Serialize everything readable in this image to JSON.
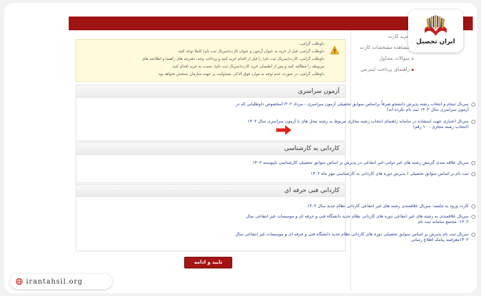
{
  "logo": {
    "text": "ایران تحصیل"
  },
  "sidebar": {
    "items": [
      {
        "label": "خرید کارت",
        "active": false
      },
      {
        "label": "مشاهده مشخصات کارت",
        "active": false
      },
      {
        "label": "سوالات متداول",
        "active": false
      },
      {
        "label": "راهنمای پرداخت اینترنتی",
        "active": true
      }
    ]
  },
  "notice": {
    "lines": [
      "داوطلب گرامی،",
      "داوطلب گرامی، قبل از خرید به عنوان آزمون و عنوان کارت(سریال ثبت نام) کاملا توجه کنید.",
      "داوطلب گرامی، کارت(سریال ثبت نام) را قبل از اقدام خرید کنید و پرداخت وجه، دفترچه های راهنما و اطلاعیه های",
      "مربوطه را مطالعه کنید و پس از اطمینان خرید کارت(سریال ثبت نام)، نسبت به خرید اقدام کنید.",
      "داوطلب گرامی، در صورت عدم توجه به موارد فوق الذکر، مسئولیت بر عهده سازمان سنجش نخواهد بود."
    ]
  },
  "sections": [
    {
      "title": "آزمون سراسری",
      "options": [
        "سریال ثبتنام و انتخاب رشته پذیرش دانشجو صرفاً براساس سوابق تحصیلی آزمون سراسری - مرداد ۱۴۰۲(مخصوص داوطلبانی که در آزمون سراسری سال ۱۴۰۲ ثبت نام نکرده اند)",
        "سریال اعتباری جهت استفاده در سامانه راهنمای انتخاب رشته مجازی مربوط به رشته محل های با آزمون سراسری سال ۱۴۰۲ (انتخاب رشته مجازی - ۱۰ رقم)"
      ]
    },
    {
      "title": "کاردانی به کارشناسی",
      "options": [
        "سریال علاقه مندی گزینش رشته های غیر دولتی-غیر انتفاعی در پذیرش بر اساس سوابق تحصیلی کارشناسی ناپیوسته ۱۴۰۲",
        "ثبت نام بر اساس سوابق تحصیلی ( پذیرش دوره های کاردانی به کارشناسی مهر ماه ۱۴۰۲"
      ]
    },
    {
      "title": "کاردانی فنی حرفه ای",
      "options": [
        "کارت ورود به جلسه: سریال علاقمندی رشته های غیر انتفاعی کاردانی نظام جدید سال ۱۴۰۲",
        "سریال علاقمندی به رشته های غیر انتفاعی دوره های کاردانی نظام جدید دانشگاه فنی و حرفه ای و موسسات غیر انتفاعی سال ۱۴۰۲- مجتمع سامانه ثبت نام",
        "سریال ثبت نام پذیرش بر اساس سوابق تحصیلی دوره های کاردانی نظام جدید دانشگاه فنی و حرفه ای و موسسات غیر انتفاعی سال ۱۴۰۲معرفینه پیامک اطلاع رسانی"
      ]
    }
  ],
  "confirm_button": {
    "label": "تایید و ادامه"
  },
  "watermark": {
    "text": "irantahsil.org"
  },
  "colors": {
    "brand_red": "#a01313",
    "link_blue": "#1d3a8c",
    "notice_bg": "#fefadb",
    "arrow_red": "#e3201b"
  }
}
